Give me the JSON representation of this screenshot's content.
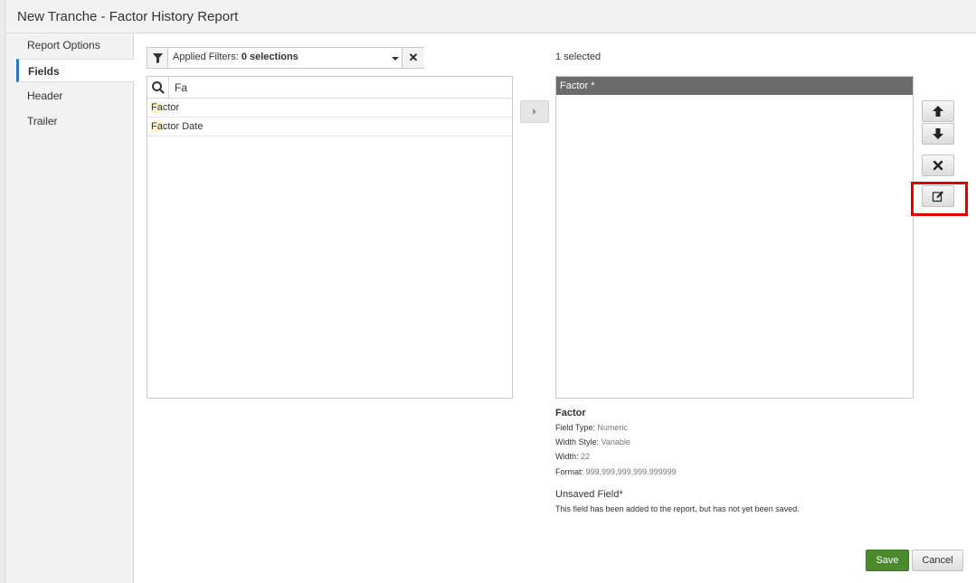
{
  "window": {
    "title": "New Tranche - Factor History Report"
  },
  "sidebar": {
    "items": [
      {
        "label": "Report Options",
        "active": false
      },
      {
        "label": "Fields",
        "active": true
      },
      {
        "label": "Header",
        "active": false
      },
      {
        "label": "Trailer",
        "active": false
      }
    ]
  },
  "filters": {
    "label": "Applied Filters:",
    "value": "0 selections"
  },
  "search": {
    "value": "Fa",
    "placeholder": ""
  },
  "available_fields": [
    {
      "highlight": "Fa",
      "rest": "ctor"
    },
    {
      "highlight": "Fa",
      "rest": "ctor Date"
    }
  ],
  "selected": {
    "count_label": "1 selected",
    "items": [
      {
        "label": "Factor *"
      }
    ]
  },
  "details": {
    "name": "Factor",
    "field_type_label": "Field Type:",
    "field_type": "Numeric",
    "width_style_label": "Width Style:",
    "width_style": "Variable",
    "width_label": "Width:",
    "width": "22",
    "format_label": "Format:",
    "format": "999,999,999,999.999999",
    "unsaved_title": "Unsaved Field*",
    "unsaved_message": "This field has been added to the report, but has not yet been saved."
  },
  "actions": {
    "save": "Save",
    "cancel": "Cancel"
  },
  "colors": {
    "accent": "#2a7ab0",
    "save": "#4a8a2a",
    "selected_row": "#6b6b6b",
    "annotation": "#e00000",
    "match_highlight": "#fdf6cc"
  },
  "icons": [
    "filter-icon",
    "caret-down-icon",
    "close-icon",
    "search-icon",
    "chevron-right-icon",
    "arrow-up-icon",
    "arrow-down-icon",
    "remove-icon",
    "edit-icon"
  ]
}
